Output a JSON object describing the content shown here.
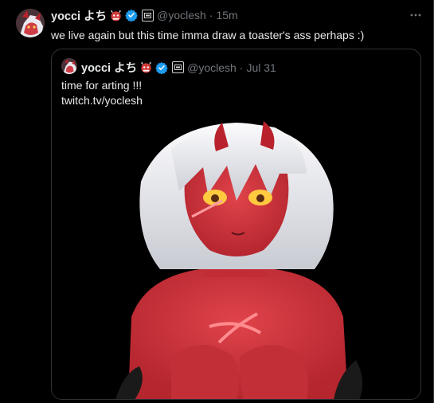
{
  "post": {
    "display_name": "yocci よち",
    "handle": "@yoclesh",
    "separator": "·",
    "time": "15m",
    "text": "we live again but this time imma draw a toaster's ass perhaps :)"
  },
  "quote": {
    "display_name": "yocci よち",
    "handle": "@yoclesh",
    "separator": "·",
    "time": "Jul 31",
    "text_line1": "time for arting !!!",
    "text_line2": "twitch.tv/yoclesh"
  },
  "icons": {
    "emoji": "ogre-mask-emoji-icon",
    "verified": "verified-badge-icon",
    "affiliate": "affiliate-badge-icon",
    "more": "more-dots-icon"
  },
  "colors": {
    "background": "#000000",
    "text_primary": "#e7e9ea",
    "text_secondary": "#71767b",
    "border": "#2f3336",
    "verified_blue": "#1d9bf0",
    "skin_red": "#d8373f"
  }
}
